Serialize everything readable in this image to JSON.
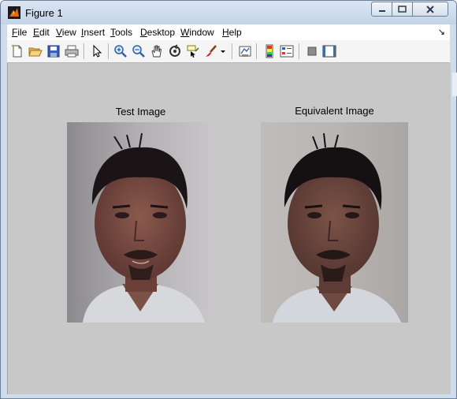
{
  "window": {
    "title": "Figure 1"
  },
  "menu": {
    "items": [
      {
        "label": "File",
        "key": "F",
        "rest": "ile"
      },
      {
        "label": "Edit",
        "key": "E",
        "rest": "dit"
      },
      {
        "label": "View",
        "key": "V",
        "rest": "iew"
      },
      {
        "label": "Insert",
        "key": "I",
        "rest": "nsert"
      },
      {
        "label": "Tools",
        "key": "T",
        "rest": "ools"
      },
      {
        "label": "Desktop",
        "key": "D",
        "rest": "esktop"
      },
      {
        "label": "Window",
        "key": "W",
        "rest": "indow"
      },
      {
        "label": "Help",
        "key": "H",
        "rest": "elp"
      }
    ]
  },
  "toolbar": {
    "icons": [
      "new-figure-icon",
      "open-file-icon",
      "save-icon",
      "print-icon",
      "select-arrow-icon",
      "zoom-in-icon",
      "zoom-out-icon",
      "pan-hand-icon",
      "rotate-3d-icon",
      "data-cursor-icon",
      "brush-icon",
      "brush-dropdown-icon",
      "link-plot-icon",
      "insert-colorbar-icon",
      "insert-legend-icon",
      "hide-plot-tools-icon",
      "show-plot-tools-icon"
    ]
  },
  "figure": {
    "left_title": "Test Image",
    "right_title": "Equivalent Image"
  },
  "colors": {
    "canvas": "#c8c8c8",
    "titlebar": "#c9d8ea"
  }
}
